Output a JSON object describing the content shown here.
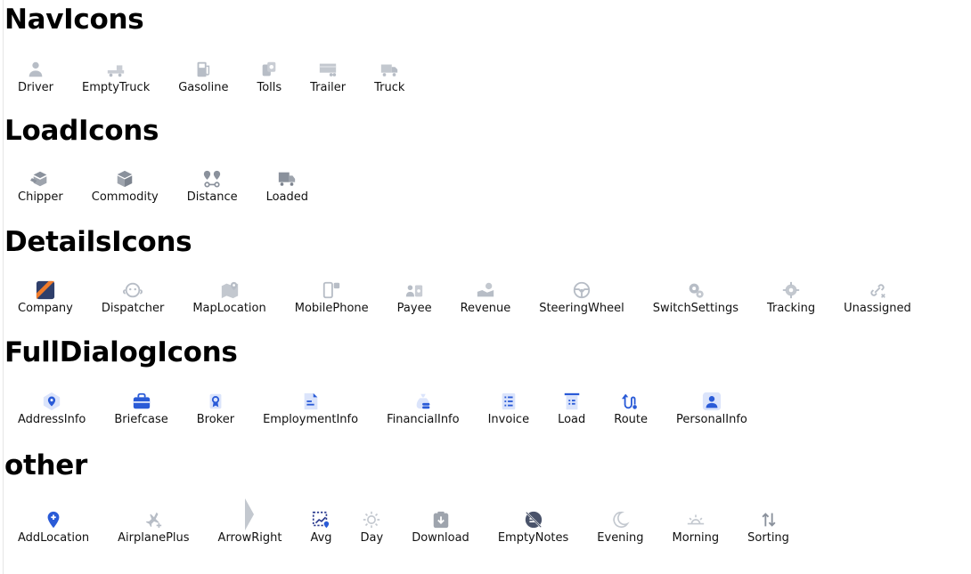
{
  "sections": [
    {
      "title": "NavIcons",
      "items": [
        {
          "label": "Driver",
          "icon": "driver-icon"
        },
        {
          "label": "EmptyTruck",
          "icon": "empty-truck-icon"
        },
        {
          "label": "Gasoline",
          "icon": "gasoline-icon"
        },
        {
          "label": "Tolls",
          "icon": "tolls-icon"
        },
        {
          "label": "Trailer",
          "icon": "trailer-icon"
        },
        {
          "label": "Truck",
          "icon": "truck-icon"
        }
      ]
    },
    {
      "title": "LoadIcons",
      "items": [
        {
          "label": "Chipper",
          "icon": "chipper-icon"
        },
        {
          "label": "Commodity",
          "icon": "commodity-icon"
        },
        {
          "label": "Distance",
          "icon": "distance-icon"
        },
        {
          "label": "Loaded",
          "icon": "loaded-icon"
        }
      ]
    },
    {
      "title": "DetailsIcons",
      "items": [
        {
          "label": "Company",
          "icon": "company-icon"
        },
        {
          "label": "Dispatcher",
          "icon": "dispatcher-icon"
        },
        {
          "label": "MapLocation",
          "icon": "map-location-icon"
        },
        {
          "label": "MobilePhone",
          "icon": "mobile-phone-icon"
        },
        {
          "label": "Payee",
          "icon": "payee-icon"
        },
        {
          "label": "Revenue",
          "icon": "revenue-icon"
        },
        {
          "label": "SteeringWheel",
          "icon": "steering-wheel-icon"
        },
        {
          "label": "SwitchSettings",
          "icon": "switch-settings-icon"
        },
        {
          "label": "Tracking",
          "icon": "tracking-icon"
        },
        {
          "label": "Unassigned",
          "icon": "unassigned-icon"
        }
      ]
    },
    {
      "title": "FullDialogIcons",
      "items": [
        {
          "label": "AddressInfo",
          "icon": "address-info-icon"
        },
        {
          "label": "Briefcase",
          "icon": "briefcase-icon"
        },
        {
          "label": "Broker",
          "icon": "broker-icon"
        },
        {
          "label": "EmploymentInfo",
          "icon": "employment-info-icon"
        },
        {
          "label": "FinancialInfo",
          "icon": "financial-info-icon"
        },
        {
          "label": "Invoice",
          "icon": "invoice-icon"
        },
        {
          "label": "Load",
          "icon": "load-icon"
        },
        {
          "label": "Route",
          "icon": "route-icon"
        },
        {
          "label": "PersonalInfo",
          "icon": "personal-info-icon"
        }
      ]
    },
    {
      "title": "other",
      "items": [
        {
          "label": "AddLocation",
          "icon": "add-location-icon"
        },
        {
          "label": "AirplanePlus",
          "icon": "airplane-plus-icon"
        },
        {
          "label": "ArrowRight",
          "icon": "arrow-right-icon"
        },
        {
          "label": "Avg",
          "icon": "avg-icon"
        },
        {
          "label": "Day",
          "icon": "day-icon"
        },
        {
          "label": "Download",
          "icon": "download-icon"
        },
        {
          "label": "EmptyNotes",
          "icon": "empty-notes-icon"
        },
        {
          "label": "Evening",
          "icon": "evening-icon"
        },
        {
          "label": "Morning",
          "icon": "morning-icon"
        },
        {
          "label": "Sorting",
          "icon": "sorting-icon"
        }
      ]
    }
  ],
  "colors": {
    "muted_icon": "#b7bdc6",
    "dark_icon": "#8a919c",
    "accent_blue": "#2a5bd7",
    "light_blue": "#dbe4fb",
    "orange": "#f07b2a"
  }
}
